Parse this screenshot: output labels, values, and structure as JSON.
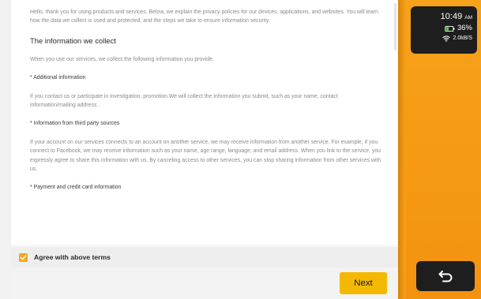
{
  "document": {
    "intro": "Hello, thank you for using products and services. Below, we explain the privacy policies for our devices, applications, and websites. You will learn how the data we collect is used and protected, and the steps we take to ensure information security.",
    "heading": "The information we collect",
    "collect_text": "When you use our services, we collect the following information you provide.",
    "section_additional_title": "* Additional information",
    "section_additional_text": "If you contact us or participate in investigation, promotion.We will collect the information you submit, such as your name, contact information/mailing address .",
    "section_third_party_title": "* Information from third party sources",
    "section_third_party_text": "If your account on our services connects to an account on another service, we may receive information from another service. For example, if you connect to Facebook, we may receive information such as your name, age range, language, and email address. When you link to the service, you expressly agree to share this information with us. By canceling access to other services, you can stop sharing information from other services with us.",
    "section_payment_title": "* Payment and credit card information"
  },
  "agree": {
    "label": "Agree with above terms",
    "checked": true
  },
  "actions": {
    "next_label": "Next"
  },
  "status": {
    "time": "10:49",
    "ampm": "AM",
    "battery": "36%",
    "network_speed": "2.0kB/S"
  },
  "colors": {
    "accent": "#f5b800",
    "side_panel": "#f7a21b",
    "status_bg": "#1e1e1e"
  },
  "icons": {
    "checkbox": "check-icon",
    "battery": "battery-icon",
    "wifi": "wifi-icon",
    "back": "back-arrow-icon"
  }
}
